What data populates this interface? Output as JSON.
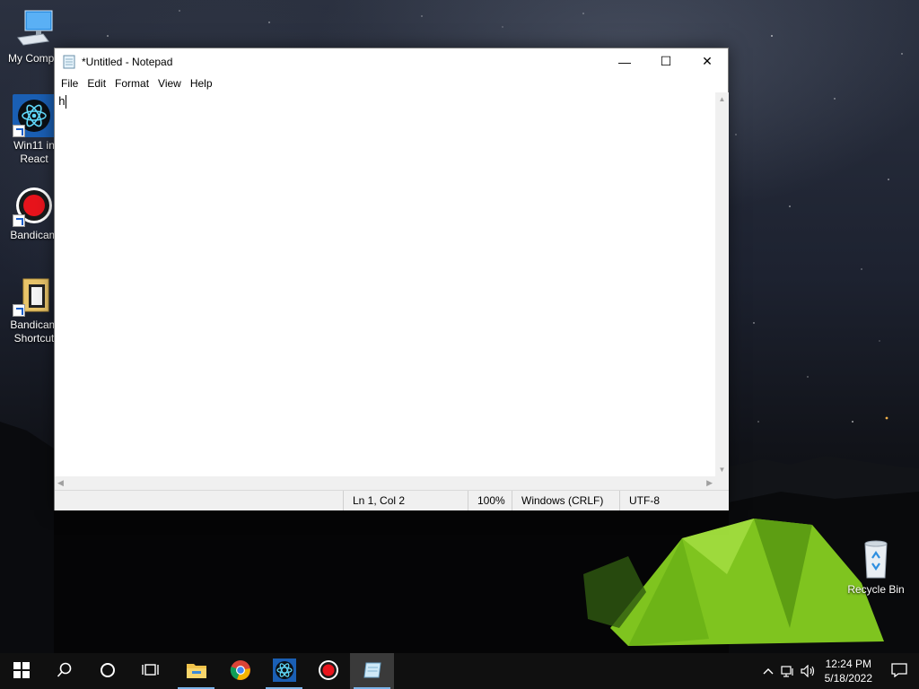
{
  "desktop": {
    "icons": [
      {
        "label": "My Compu"
      },
      {
        "label": "Win11 in React"
      },
      {
        "label": "Bandicam"
      },
      {
        "label": "Bandicam Shortcut"
      }
    ],
    "recycle_bin": {
      "label": "Recycle Bin"
    }
  },
  "notepad": {
    "title": "*Untitled - Notepad",
    "menu": [
      "File",
      "Edit",
      "Format",
      "View",
      "Help"
    ],
    "content": "h",
    "status": {
      "position": "Ln 1, Col 2",
      "zoom": "100%",
      "line_ending": "Windows (CRLF)",
      "encoding": "UTF-8"
    },
    "window_buttons": {
      "minimize": "—",
      "maximize": "☐",
      "close": "✕"
    }
  },
  "taskbar": {
    "apps": [
      {
        "name": "file-explorer-icon",
        "active": false
      },
      {
        "name": "chrome-icon",
        "active": false
      },
      {
        "name": "react-icon",
        "active": false
      },
      {
        "name": "bandicam-icon",
        "active": false
      },
      {
        "name": "notepad-icon",
        "active": true
      }
    ],
    "clock": {
      "time": "12:24 PM",
      "date": "5/18/2022"
    }
  },
  "colors": {
    "accent_underline": "#7ab3e8",
    "tent_green": "#8fd12a",
    "taskbar": "#101010"
  }
}
